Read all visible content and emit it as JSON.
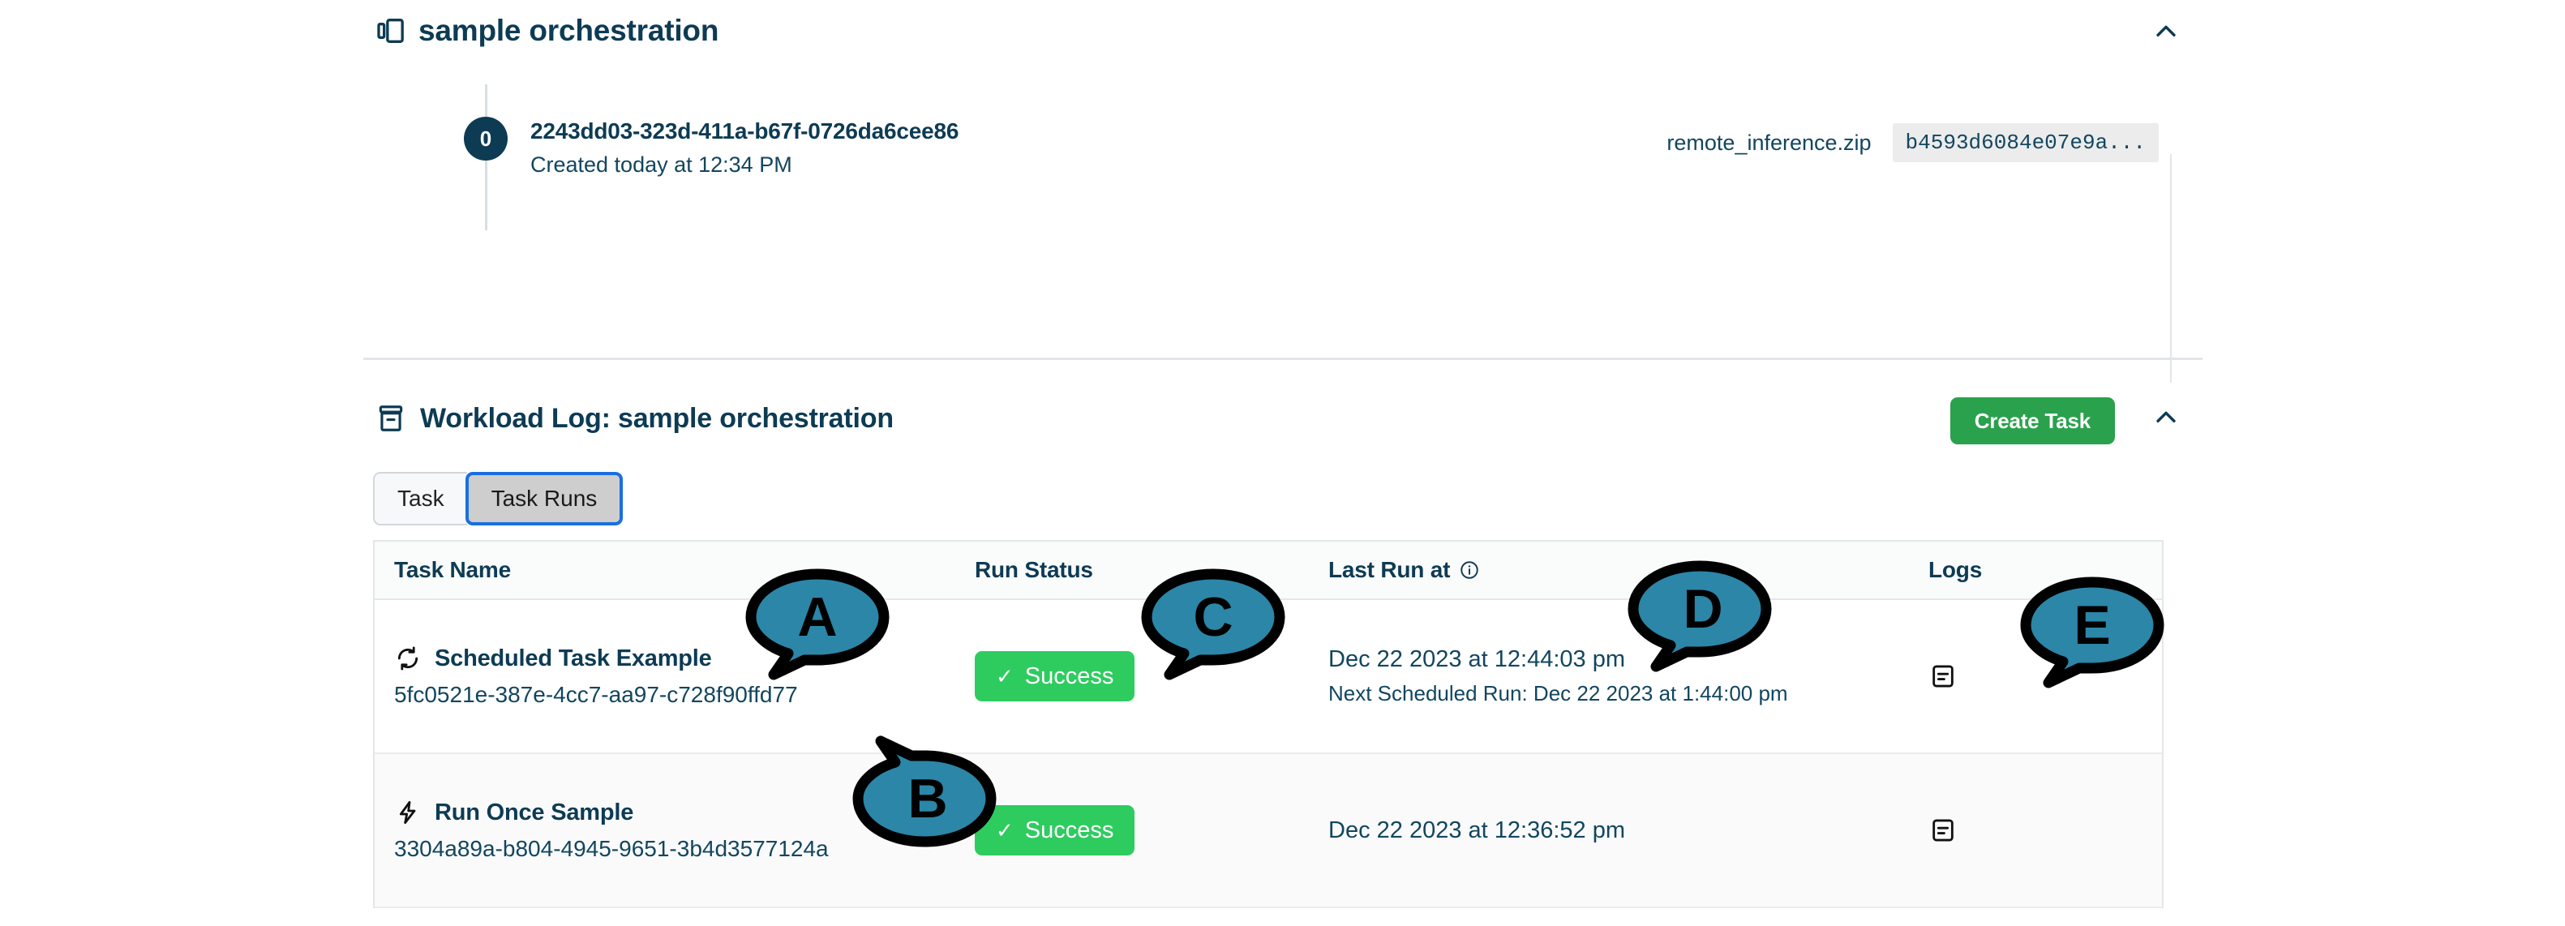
{
  "section_one": {
    "icon": "columns-icon",
    "title": "sample orchestration",
    "collapse_icon": "chevron-up-icon",
    "timeline": {
      "node_label": "0",
      "run_id": "2243dd03-323d-411a-b67f-0726da6cee86",
      "created": "Created today at 12:34 PM",
      "artifact_name": "remote_inference.zip",
      "artifact_hash": "b4593d6084e07e9a..."
    }
  },
  "section_two": {
    "icon": "archive-box-icon",
    "title": "Workload Log: sample orchestration",
    "create_task_label": "Create Task",
    "collapse_icon": "chevron-up-icon",
    "tabs": [
      {
        "label": "Task",
        "selected": false
      },
      {
        "label": "Task Runs",
        "selected": true
      }
    ],
    "table": {
      "columns": [
        {
          "label": "Task Name",
          "info": false
        },
        {
          "label": "Run Status",
          "info": false
        },
        {
          "label": "Last Run at",
          "info": true
        },
        {
          "label": "Logs",
          "info": false
        }
      ],
      "rows": [
        {
          "task_icon": "refresh-cycle-icon",
          "task_name": "Scheduled Task Example",
          "task_uuid": "5fc0521e-387e-4cc7-aa97-c728f90ffd77",
          "status": "Success",
          "status_icon": "check-icon",
          "last_run": "Dec 22 2023 at 12:44:03 pm",
          "next_run": "Next Scheduled Run: Dec 22 2023 at 1:44:00 pm",
          "logs_icon": "document-list-icon"
        },
        {
          "task_icon": "lightning-bolt-icon",
          "task_name": "Run Once Sample",
          "task_uuid": "3304a89a-b804-4945-9651-3b4d3577124a",
          "status": "Success",
          "status_icon": "check-icon",
          "last_run": "Dec 22 2023 at 12:36:52 pm",
          "next_run": "",
          "logs_icon": "document-list-icon"
        }
      ]
    }
  },
  "callouts": [
    {
      "label": "A",
      "tail": "down-left"
    },
    {
      "label": "B",
      "tail": "up-left"
    },
    {
      "label": "C",
      "tail": "down-left"
    },
    {
      "label": "D",
      "tail": "down-left"
    },
    {
      "label": "E",
      "tail": "down-left"
    }
  ],
  "colors": {
    "brand_dark": "#0d3b54",
    "success_green": "#2ecc5f",
    "create_button_green": "#2aa14c",
    "tab_focus_blue": "#1a6fe0",
    "callout_teal": "#2b86a8",
    "hash_bg": "#ececec"
  }
}
